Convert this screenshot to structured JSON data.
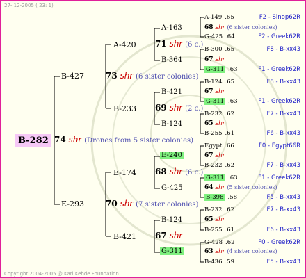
{
  "header": {
    "date": "27- 12-2005 ( 23: 1)"
  },
  "footer": {
    "copyright": "Copyright 2004-2005 @ Karl Kehde Foundation."
  },
  "root": {
    "label": "B-282",
    "num": "74",
    "shr": "shr",
    "note": "(Drones from 5 sister colonies)"
  },
  "l1": [
    {
      "label": "B-427",
      "num": "73",
      "shr": "shr",
      "note": "(6 sister colonies)"
    },
    {
      "label": "E-293",
      "num": "70",
      "shr": "shr",
      "note": "(7 sister colonies)"
    }
  ],
  "l2": [
    {
      "label": "A-420",
      "num": "71",
      "shr": "shr",
      "note": "(6 c.)"
    },
    {
      "label": "B-233",
      "num": "69",
      "shr": "shr",
      "note": "(2 c.)"
    },
    {
      "label": "E-174",
      "num": "68",
      "shr": "shr",
      "note": "(6 c.)"
    },
    {
      "label": "B-421",
      "num": "67",
      "shr": "shr",
      "note": ""
    }
  ],
  "l3": [
    {
      "label": "A-163",
      "num": "68",
      "shr": "shr",
      "note": "(6 sister colonies)"
    },
    {
      "label": "B-364",
      "num": "67",
      "shr": "shr",
      "note": ""
    },
    {
      "label": "B-421",
      "num": "67",
      "shr": "shr",
      "note": ""
    },
    {
      "label": "B-124",
      "num": "65",
      "shr": "shr",
      "note": ""
    },
    {
      "label": "E-240",
      "num": "67",
      "shr": "shr",
      "note": ""
    },
    {
      "label": "G-425",
      "num": "64",
      "shr": "shr",
      "note": "(5 sister colonies)"
    },
    {
      "label": "B-124",
      "num": "65",
      "shr": "shr",
      "note": ""
    },
    {
      "label": "G-311",
      "num": "63",
      "shr": "shr",
      "note": "(4 sister colonies)"
    }
  ],
  "l4": [
    {
      "label": "A-149",
      "val": ".65",
      "right": "F2 - Sinop62R"
    },
    {
      "label": "G-425",
      "val": ".64",
      "right": "F2 - Greek62R"
    },
    {
      "label": "B-300",
      "val": ".65",
      "right": "F8 - B-xx43"
    },
    {
      "label": "G-311",
      "val": ".63",
      "right": "F1 - Greek62R"
    },
    {
      "label": "B-124",
      "val": ".65",
      "right": "F8 - B-xx43"
    },
    {
      "label": "G-311",
      "val": ".63",
      "right": "F1 - Greek62R"
    },
    {
      "label": "B-232",
      "val": ".62",
      "right": "F7 - B-xx43"
    },
    {
      "label": "B-255",
      "val": ".61",
      "right": "F6 - B-xx43"
    },
    {
      "label": "Egypt",
      "val": ".66",
      "right": "F0 - Egypt66R"
    },
    {
      "label": "B-232",
      "val": ".62",
      "right": "F7 - B-xx43"
    },
    {
      "label": "G-311",
      "val": ".63",
      "right": "F1 - Greek62R"
    },
    {
      "label": "B-398",
      "val": ".58",
      "right": "F5 - B-xx43"
    },
    {
      "label": "B-232",
      "val": ".62",
      "right": "F7 - B-xx43"
    },
    {
      "label": "B-255",
      "val": ".61",
      "right": "F6 - B-xx43"
    },
    {
      "label": "G-428",
      "val": ".62",
      "right": "F0 - Greek62R"
    },
    {
      "label": "B-436",
      "val": ".59",
      "right": "F5 - B-xx43"
    }
  ],
  "colors": {
    "border": "#e0209a",
    "highlight": "#7ff07f",
    "root_bg": "#f6c8f6",
    "shr": "#cc0000",
    "colony_note": "#5050b0",
    "right_label": "#2020c8"
  }
}
